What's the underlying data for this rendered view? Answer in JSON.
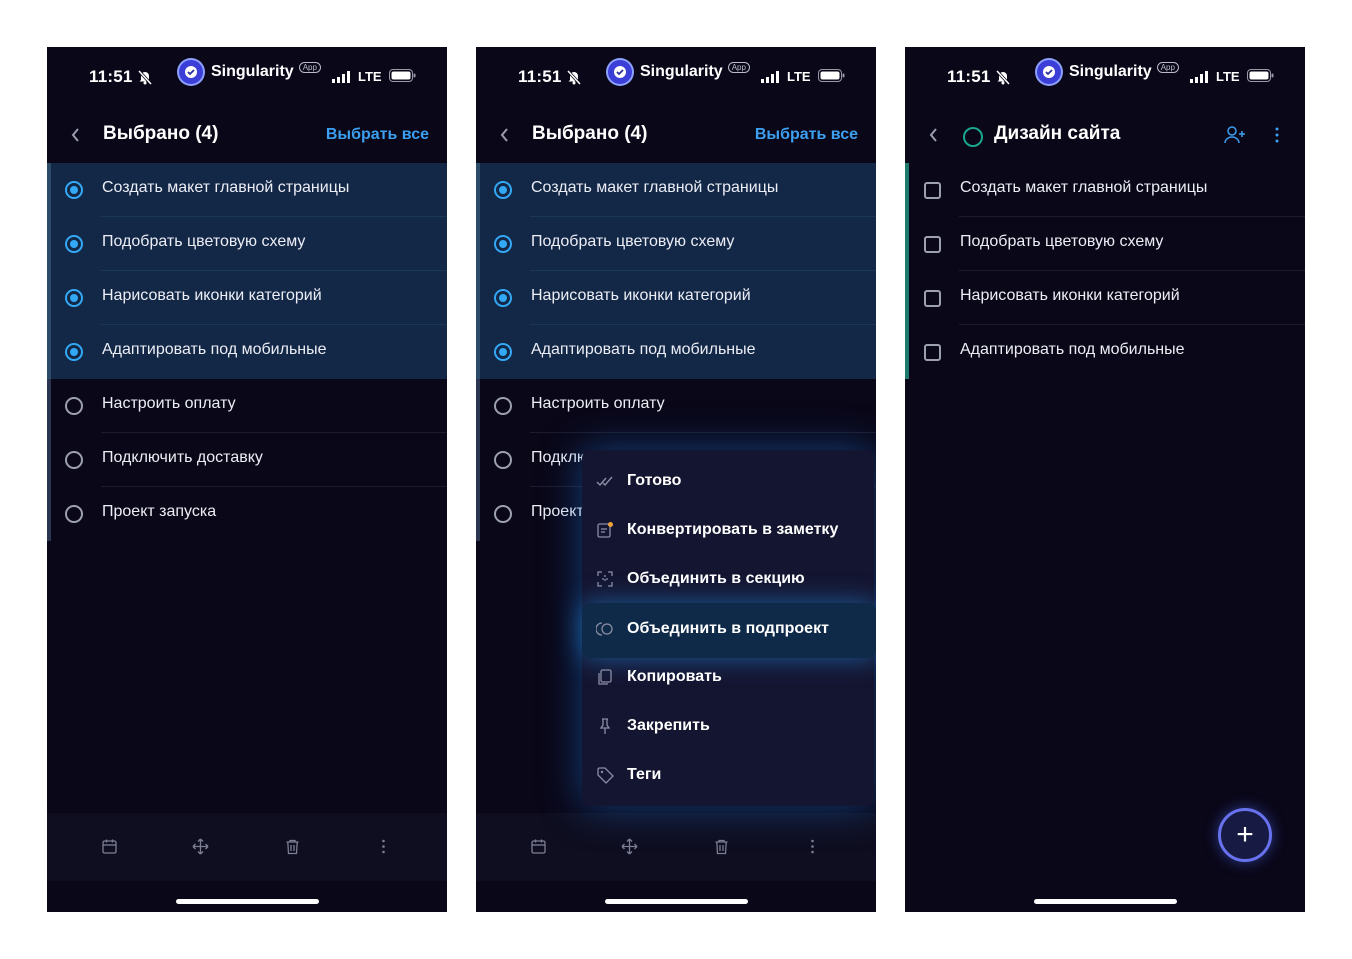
{
  "status_bar": {
    "time": "11:51",
    "app_name": "Singularity",
    "app_badge": "App",
    "network": "LTE"
  },
  "selection_header": {
    "title": "Выбрано (4)",
    "select_all": "Выбрать все"
  },
  "project_header": {
    "title": "Дизайн сайта"
  },
  "tasks_all": [
    {
      "label": "Создать макет главной страницы",
      "selected": true
    },
    {
      "label": "Подобрать цветовую схему",
      "selected": true
    },
    {
      "label": "Нарисовать иконки категорий",
      "selected": true
    },
    {
      "label": "Адаптировать под мобильные",
      "selected": true
    },
    {
      "label": "Настроить оплату",
      "selected": false
    },
    {
      "label": "Подключить доставку",
      "selected": false
    },
    {
      "label": "Проект запуска",
      "selected": false
    }
  ],
  "tasks_panel2_truncated": {
    "row6": "Подклю",
    "row7": "Проект"
  },
  "context_menu": [
    {
      "label": "Готово",
      "icon": "double-check-icon"
    },
    {
      "label": "Конвертировать в заметку",
      "icon": "note-icon"
    },
    {
      "label": "Объединить в секцию",
      "icon": "section-icon"
    },
    {
      "label": "Объединить в подпроект",
      "icon": "subproject-icon",
      "highlighted": true
    },
    {
      "label": "Копировать",
      "icon": "copy-icon"
    },
    {
      "label": "Закрепить",
      "icon": "pin-icon"
    },
    {
      "label": "Теги",
      "icon": "tag-icon"
    }
  ],
  "project_tasks": [
    {
      "label": "Создать макет главной страницы"
    },
    {
      "label": "Подобрать цветовую схему"
    },
    {
      "label": "Нарисовать иконки категорий"
    },
    {
      "label": "Адаптировать под мобильные"
    }
  ],
  "toolbar_icons": [
    "calendar-icon",
    "move-icon",
    "trash-icon",
    "more-vertical-icon"
  ],
  "fab": {
    "symbol": "+"
  },
  "colors": {
    "background": "#0a0718",
    "selected_row": "#132747",
    "accent": "#33a8f5",
    "link": "#3c9ff0",
    "project": "#1aa68f",
    "fab_ring": "#6872ee"
  }
}
